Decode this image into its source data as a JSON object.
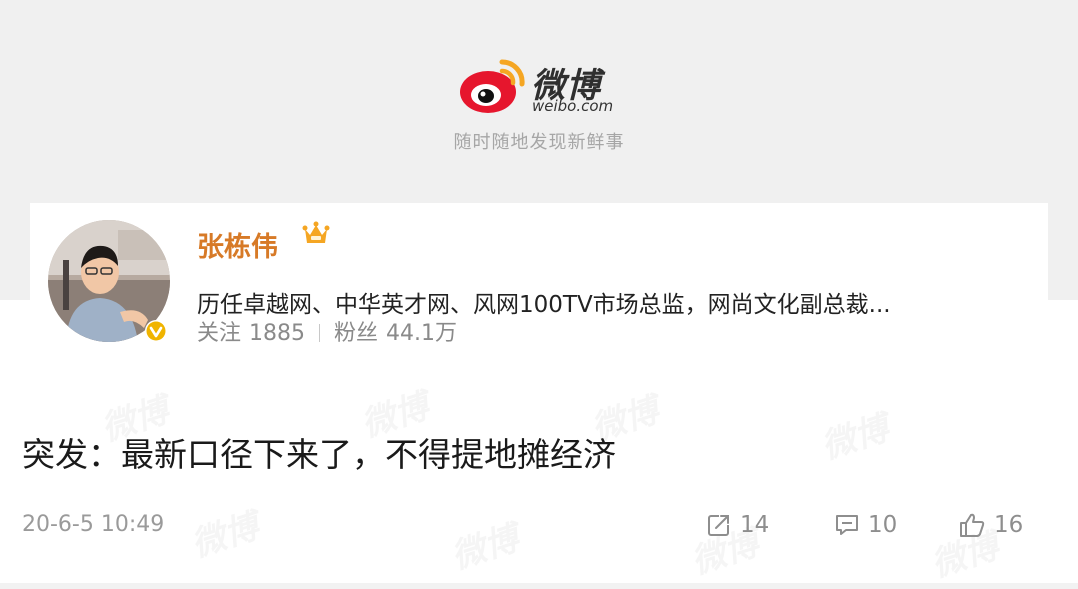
{
  "brand": {
    "name": "微博",
    "domain": "weibo.com",
    "tagline": "随时随地发现新鲜事",
    "logo_color": "#e6162d",
    "accent_color": "#f5a623"
  },
  "profile": {
    "username": "张栋伟",
    "bio": "历任卓越网、中华英才网、风网100TV市场总监，网尚文化副总裁...",
    "following_label": "关注",
    "following_count": "1885",
    "followers_label": "粉丝",
    "followers_count": "44.1万",
    "username_color": "#d77a27",
    "verified_color": "#f0b400"
  },
  "post": {
    "text": "突发：最新口径下来了，不得提地摊经济",
    "timestamp": "20-6-5 10:49"
  },
  "actions": {
    "repost_count": "14",
    "comment_count": "10",
    "like_count": "16"
  }
}
